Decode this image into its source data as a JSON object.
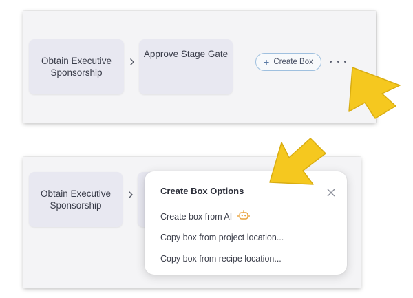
{
  "top_panel": {
    "cards": [
      {
        "line1": "Obtain Executive",
        "line2": "Sponsorship"
      },
      {
        "line1": "Approve Stage Gate"
      }
    ],
    "create_button": {
      "icon": "+",
      "label": "Create Box"
    },
    "more_icon": "ellipsis-icon"
  },
  "bottom_panel": {
    "cards": [
      {
        "line1": "Obtain Executive",
        "line2": "Sponsorship"
      }
    ]
  },
  "popup": {
    "title": "Create Box Options",
    "items": [
      {
        "label": "Create box from AI",
        "icon": "ai-robot-icon"
      },
      {
        "label": "Copy box from project location..."
      },
      {
        "label": "Copy box from recipe location..."
      }
    ]
  },
  "colors": {
    "arrow": "#f5c81f",
    "card": "#e8e8f1",
    "button_border": "#9fc0df",
    "ai_icon": "#e9a23b"
  }
}
